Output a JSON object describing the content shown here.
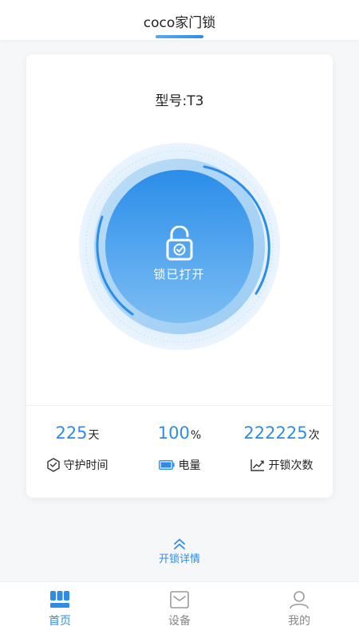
{
  "header": {
    "title": "coco家门锁"
  },
  "device": {
    "model_label": "型号:",
    "model_value": "T3",
    "lock_status": "锁已打开"
  },
  "stats": [
    {
      "value": "225",
      "unit": "天",
      "label": "守护时间",
      "icon": "shield-icon"
    },
    {
      "value": "100",
      "unit": "%",
      "label": "电量",
      "icon": "battery-icon"
    },
    {
      "value": "222225",
      "unit": "次",
      "label": "开锁次数",
      "icon": "trend-chart-icon"
    }
  ],
  "battery_level": 1.0,
  "details_link": {
    "label": "开锁详情",
    "icon": "chevron-double-up-icon"
  },
  "tabbar": [
    {
      "label": "首页",
      "icon": "home-icon",
      "active": true
    },
    {
      "label": "设备",
      "icon": "device-icon",
      "active": false
    },
    {
      "label": "我的",
      "icon": "profile-icon",
      "active": false
    }
  ],
  "colors": {
    "accent": "#2f8ce6",
    "accent_light": "#7ec0f3",
    "inactive": "#888888"
  }
}
